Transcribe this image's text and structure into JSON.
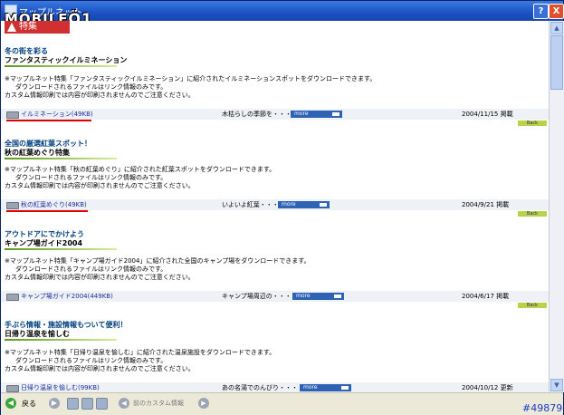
{
  "window": {
    "title": "マップルネット",
    "watermark": "MOBILE",
    "watermark_glyph": "Ö1",
    "help": "?",
    "close": "X"
  },
  "header": {
    "tab_label": "特集"
  },
  "sections": [
    {
      "heading": "冬の街を彩る",
      "subheading": "ファンタスティックイルミネーション",
      "desc": [
        "※マップルネット特集「ファンタスティックイルミネーション」に紹介されたイルミネーションスポットをダウンロードできます。",
        "ダウンロードされるファイルはリンク情報のみです。",
        "カスタム情報印刷では内容が印刷されませんのでご注意ください。"
      ],
      "file": "イルミネーション(49KB)",
      "summary": "木枯らしの季節を・・・",
      "more": "more",
      "date": "2004/11/15 掲載",
      "back": "Back"
    },
    {
      "heading": "全国の厳選紅葉スポット！",
      "subheading": "秋の紅葉めぐり特集",
      "desc": [
        "※マップルネット特集「秋の紅葉めぐり」に紹介された紅葉スポットをダウンロードできます。",
        "ダウンロードされるファイルはリンク情報のみです。",
        "カスタム情報印刷では内容が印刷されませんのでご注意ください。"
      ],
      "file": "秋の紅葉めぐり(49KB)",
      "summary": "いよいよ紅葉・・・",
      "more": "more",
      "date": "2004/9/21 掲載",
      "back": "Back"
    },
    {
      "heading": "アウトドアにでかけよう",
      "subheading": "キャンプ場ガイド2004",
      "desc": [
        "※マップルネット特集「キャンプ場ガイド2004」に紹介された全国のキャンプ場をダウンロードできます。",
        "ダウンロードされるファイルはリンク情報のみです。",
        "カスタム情報印刷では内容が印刷されませんのでご注意ください。"
      ],
      "file": "キャンプ場ガイド2004(449KB)",
      "summary": "キャンプ場周辺の・・・",
      "more": "more",
      "date": "2004/6/17 掲載",
      "back": "Back"
    },
    {
      "heading": "手ぶら情報・施設情報もついて便利！",
      "subheading": "日帰り温泉を愉しむ",
      "desc": [
        "※マップルネット特集「日帰り温泉を愉しむ」に紹介された温泉施設をダウンロードできます。",
        "ダウンロードされるファイルはリンク情報のみです。",
        "カスタム情報印刷では内容が印刷されませんのでご注意ください。"
      ],
      "file": "日帰り温泉を愉しむ(99KB)",
      "summary": "あの名湯でのんびり・・・",
      "more": "more",
      "date": "2004/10/12 更新"
    }
  ],
  "toolbar": {
    "back_label": "戻る",
    "next_label": "前のカスタム情報"
  },
  "post_number": "#49879"
}
